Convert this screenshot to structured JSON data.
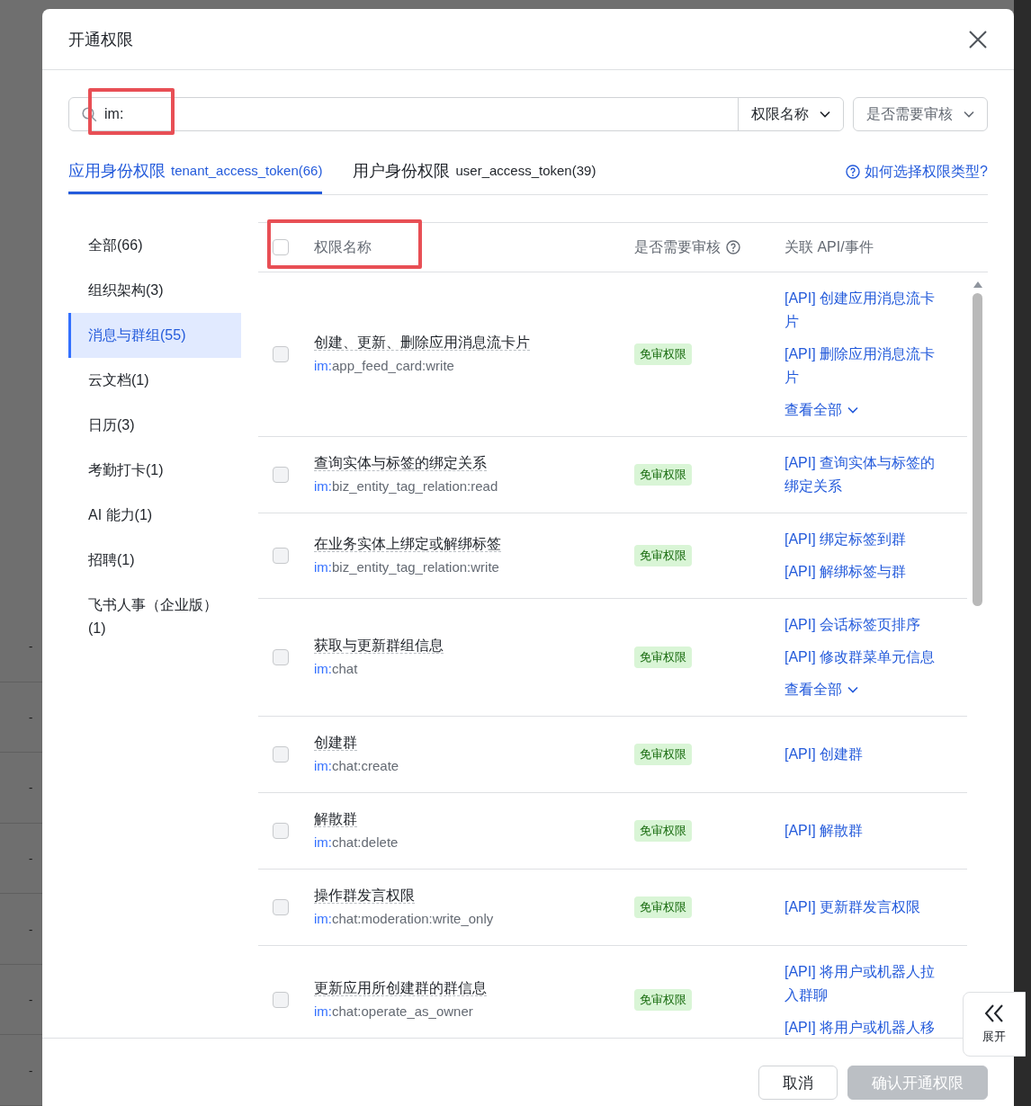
{
  "background": {
    "row_marks": [
      "-",
      "-",
      "-",
      "-",
      "-",
      "-",
      "-"
    ]
  },
  "dialog": {
    "title": "开通权限",
    "search": {
      "value": "im:",
      "highlighted": true
    },
    "filters": [
      {
        "label": "权限名称",
        "kind": "attached"
      },
      {
        "label": "是否需要审核",
        "kind": "separate"
      }
    ],
    "tabs": [
      {
        "label": "应用身份权限",
        "token": "tenant_access_token(66)",
        "selected": true
      },
      {
        "label": "用户身份权限",
        "token": "user_access_token(39)",
        "selected": false
      }
    ],
    "help_link": "如何选择权限类型?",
    "sidebar": {
      "items": [
        {
          "label": "全部(66)",
          "selected": false
        },
        {
          "label": "组织架构(3)",
          "selected": false
        },
        {
          "label": "消息与群组(55)",
          "selected": true
        },
        {
          "label": "云文档(1)",
          "selected": false
        },
        {
          "label": "日历(3)",
          "selected": false
        },
        {
          "label": "考勤打卡(1)",
          "selected": false
        },
        {
          "label": "AI 能力(1)",
          "selected": false
        },
        {
          "label": "招聘(1)",
          "selected": false
        },
        {
          "label": "飞书人事（企业版）(1)",
          "selected": false
        }
      ]
    },
    "table": {
      "header_checked": false,
      "header_highlighted": true,
      "columns": [
        {
          "label": "权限名称",
          "kind": "plain"
        },
        {
          "label": "是否需要审核",
          "kind": "with_help"
        },
        {
          "label": "关联 API/事件",
          "kind": "plain"
        }
      ],
      "rows": [
        {
          "checked": false,
          "name": "创建、更新、删除应用消息流卡片",
          "scope_prefix": "im:",
          "scope": "app_feed_card:write",
          "badge": "免审权限",
          "apis": [
            "[API] 创建应用消息流卡片",
            "[API] 删除应用消息流卡片"
          ],
          "view_all": "查看全部"
        },
        {
          "checked": false,
          "name": "查询实体与标签的绑定关系",
          "scope_prefix": "im:",
          "scope": "biz_entity_tag_relation:read",
          "badge": "免审权限",
          "apis": [
            "[API] 查询实体与标签的绑定关系"
          ]
        },
        {
          "checked": false,
          "name": "在业务实体上绑定或解绑标签",
          "scope_prefix": "im:",
          "scope": "biz_entity_tag_relation:write",
          "badge": "免审权限",
          "apis": [
            "[API] 绑定标签到群",
            "[API] 解绑标签与群"
          ]
        },
        {
          "checked": false,
          "name": "获取与更新群组信息",
          "scope_prefix": "im:",
          "scope": "chat",
          "badge": "免审权限",
          "apis": [
            "[API] 会话标签页排序",
            "[API] 修改群菜单元信息"
          ],
          "view_all": "查看全部"
        },
        {
          "checked": false,
          "name": "创建群",
          "scope_prefix": "im:",
          "scope": "chat:create",
          "badge": "免审权限",
          "apis": [
            "[API] 创建群"
          ]
        },
        {
          "checked": false,
          "name": "解散群",
          "scope_prefix": "im:",
          "scope": "chat:delete",
          "badge": "免审权限",
          "apis": [
            "[API] 解散群"
          ]
        },
        {
          "checked": false,
          "name": "操作群发言权限",
          "scope_prefix": "im:",
          "scope": "chat:moderation:write_only",
          "badge": "免审权限",
          "apis": [
            "[API] 更新群发言权限"
          ]
        },
        {
          "checked": false,
          "name": "更新应用所创建群的群信息",
          "scope_prefix": "im:",
          "scope": "chat:operate_as_owner",
          "badge": "免审权限",
          "apis": [
            "[API] 将用户或机器人拉入群聊",
            "[API] 将用户或机器人移"
          ]
        }
      ]
    },
    "buttons": [
      {
        "label": "取消",
        "disabled": false,
        "kind": "secondary"
      },
      {
        "label": "确认开通权限",
        "disabled": true,
        "kind": "primary"
      }
    ],
    "expand_button": {
      "label": "展开"
    }
  }
}
